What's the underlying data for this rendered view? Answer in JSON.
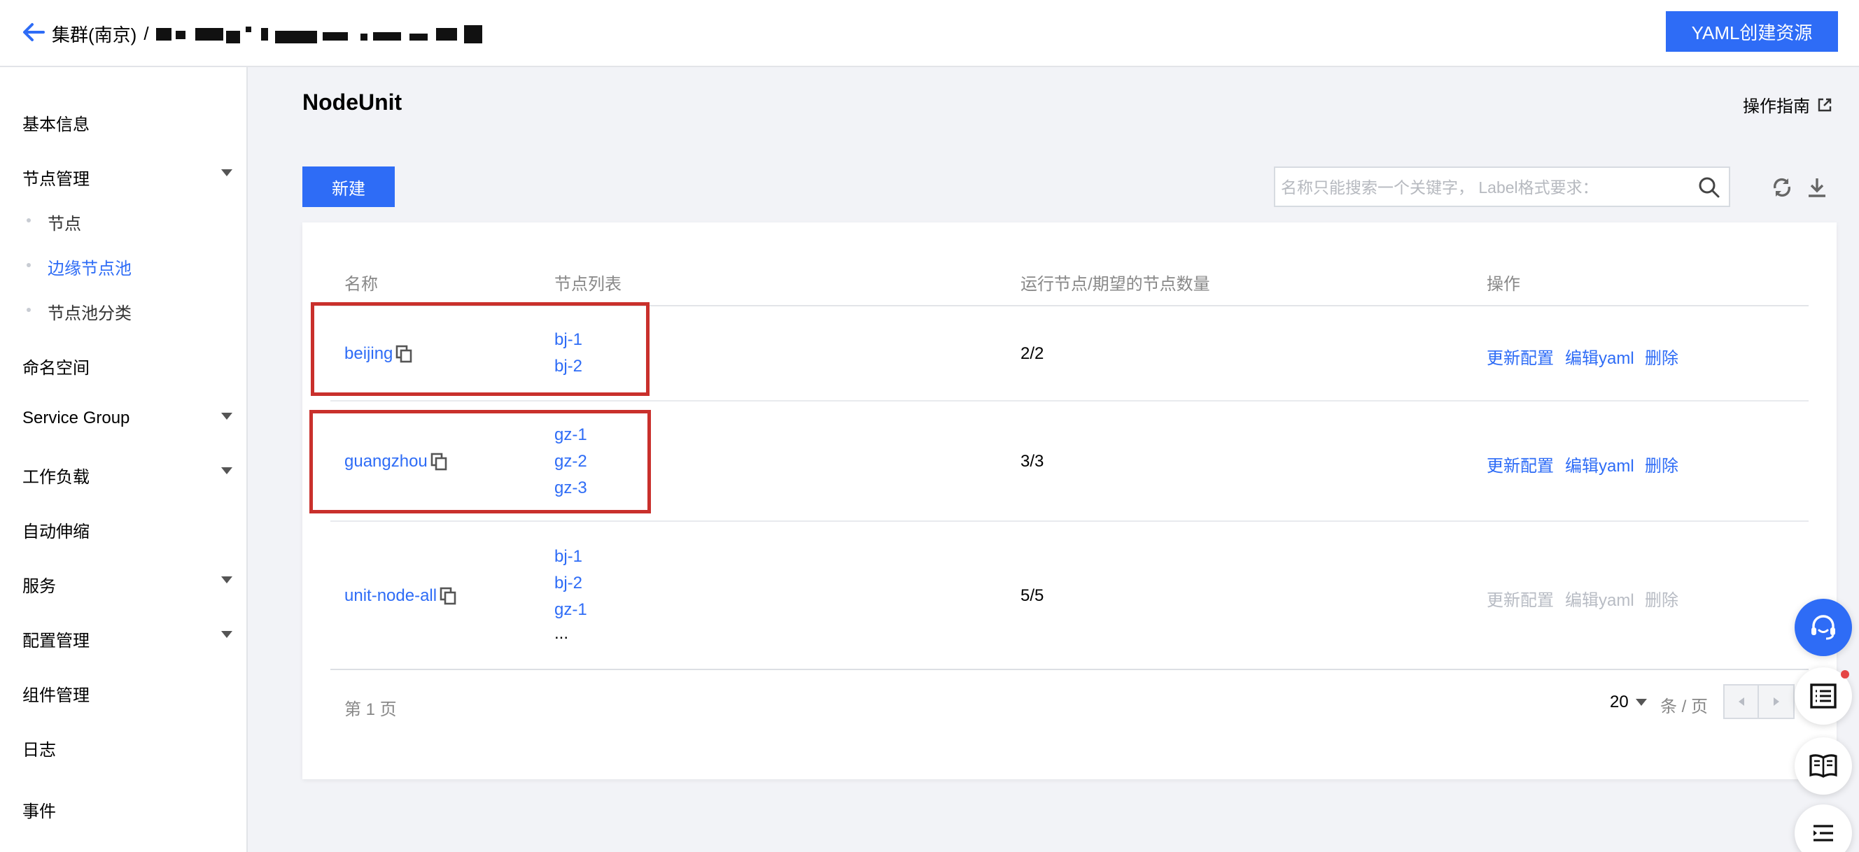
{
  "header": {
    "breadcrumb_cluster": "集群(南京)",
    "breadcrumb_sep": "/",
    "yaml_button": "YAML创建资源"
  },
  "sidebar": {
    "items": [
      {
        "label": "基本信息"
      },
      {
        "label": "节点管理",
        "expandable": true
      },
      {
        "label": "节点",
        "sub": true
      },
      {
        "label": "边缘节点池",
        "sub": true,
        "active": true
      },
      {
        "label": "节点池分类",
        "sub": true
      },
      {
        "label": "命名空间"
      },
      {
        "label": "Service Group",
        "expandable": true
      },
      {
        "label": "工作负载",
        "expandable": true
      },
      {
        "label": "自动伸缩"
      },
      {
        "label": "服务",
        "expandable": true
      },
      {
        "label": "配置管理",
        "expandable": true
      },
      {
        "label": "组件管理"
      },
      {
        "label": "日志"
      },
      {
        "label": "事件"
      }
    ]
  },
  "main": {
    "title": "NodeUnit",
    "guide_link": "操作指南",
    "new_button": "新建",
    "search_placeholder": "名称只能搜索一个关键字， Label格式要求：",
    "table": {
      "columns": [
        "名称",
        "节点列表",
        "运行节点/期望的节点数量",
        "操作"
      ],
      "rows": [
        {
          "name": "beijing",
          "nodes": [
            "bj-1",
            "bj-2"
          ],
          "count": "2/2",
          "ops": [
            "更新配置",
            "编辑yaml",
            "删除"
          ],
          "ops_disabled": false
        },
        {
          "name": "guangzhou",
          "nodes": [
            "gz-1",
            "gz-2",
            "gz-3"
          ],
          "count": "3/3",
          "ops": [
            "更新配置",
            "编辑yaml",
            "删除"
          ],
          "ops_disabled": false
        },
        {
          "name": "unit-node-all",
          "nodes": [
            "bj-1",
            "bj-2",
            "gz-1"
          ],
          "more": "...",
          "count": "5/5",
          "ops": [
            "更新配置",
            "编辑yaml",
            "删除"
          ],
          "ops_disabled": true
        }
      ]
    },
    "pagination": {
      "page_info": "第 1 页",
      "page_size": "20",
      "per_page_label": "条 / 页"
    }
  },
  "colors": {
    "accent": "#2e6cf6",
    "highlight_border": "#c9302c",
    "disabled": "#b8bcc4"
  }
}
